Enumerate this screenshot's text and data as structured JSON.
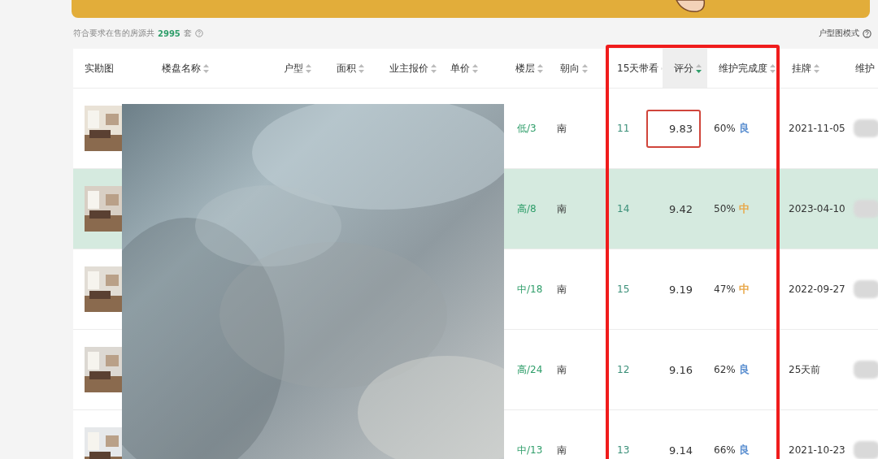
{
  "summary": {
    "prefix": "符合要求在售的房源共",
    "count": "2995",
    "suffix": "套"
  },
  "view_mode": "户型图模式",
  "columns": [
    {
      "label": "实勘图",
      "sortable": false,
      "sorted_desc": false
    },
    {
      "label": "楼盘名称",
      "sortable": true,
      "sorted_desc": false
    },
    {
      "label": "户型",
      "sortable": true,
      "sorted_desc": false
    },
    {
      "label": "面积",
      "sortable": true,
      "sorted_desc": false
    },
    {
      "label": "业主报价",
      "sortable": true,
      "sorted_desc": false
    },
    {
      "label": "单价",
      "sortable": true,
      "sorted_desc": false
    },
    {
      "label": "楼层",
      "sortable": true,
      "sorted_desc": false
    },
    {
      "label": "朝向",
      "sortable": true,
      "sorted_desc": false
    },
    {
      "label": "15天带看",
      "sortable": true,
      "sorted_desc": false
    },
    {
      "label": "评分",
      "sortable": true,
      "sorted_desc": true
    },
    {
      "label": "维护完成度",
      "sortable": true,
      "sorted_desc": false
    },
    {
      "label": "挂牌",
      "sortable": true,
      "sorted_desc": false
    },
    {
      "label": "维护"
    }
  ],
  "rows": [
    {
      "selected": false,
      "floor": "低/3",
      "orientation": "南",
      "views_15d": "11",
      "score": "9.83",
      "score_boxed": true,
      "completion": "60%",
      "grade": "良",
      "color": "#5b8fd0",
      "listed": "2021-11-05"
    },
    {
      "selected": true,
      "floor": "高/8",
      "orientation": "南",
      "views_15d": "14",
      "score": "9.42",
      "score_boxed": false,
      "completion": "50%",
      "grade": "中",
      "color": "#e8a84a",
      "listed": "2023-04-10"
    },
    {
      "selected": false,
      "floor": "中/18",
      "orientation": "南",
      "views_15d": "15",
      "score": "9.19",
      "score_boxed": false,
      "completion": "47%",
      "grade": "中",
      "color": "#e8a84a",
      "listed": "2022-09-27"
    },
    {
      "selected": false,
      "floor": "高/24",
      "orientation": "南",
      "views_15d": "12",
      "score": "9.16",
      "score_boxed": false,
      "completion": "62%",
      "grade": "良",
      "color": "#5b8fd0",
      "listed": "25天前"
    },
    {
      "selected": false,
      "floor": "中/13",
      "orientation": "南",
      "views_15d": "13",
      "score": "9.14",
      "score_boxed": false,
      "completion": "66%",
      "grade": "良",
      "color": "#5b8fd0",
      "listed": "2021-10-23"
    }
  ]
}
